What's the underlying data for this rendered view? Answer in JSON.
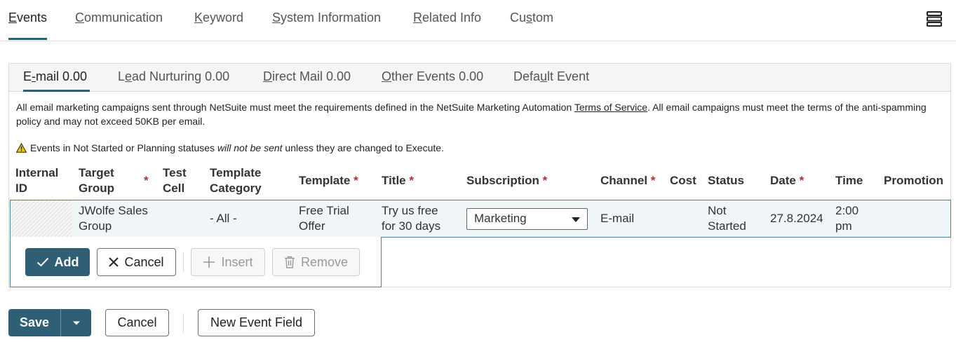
{
  "top_tabs": [
    {
      "pre": "",
      "u": "E",
      "post": "vents"
    },
    {
      "pre": "",
      "u": "C",
      "post": "ommunication"
    },
    {
      "pre": "",
      "u": "K",
      "post": "eyword"
    },
    {
      "pre": "",
      "u": "S",
      "post": "ystem Information"
    },
    {
      "pre": "",
      "u": "R",
      "post": "elated Info"
    },
    {
      "pre": "Cu",
      "u": "s",
      "post": "tom"
    }
  ],
  "sub_tabs": [
    {
      "pre": "E",
      "u": "-",
      "post": "mail 0.00"
    },
    {
      "pre": "L",
      "u": "e",
      "post": "ad Nurturing 0.00"
    },
    {
      "pre": "",
      "u": "D",
      "post": "irect Mail 0.00"
    },
    {
      "pre": "",
      "u": "O",
      "post": "ther Events 0.00"
    },
    {
      "pre": "Defa",
      "u": "u",
      "post": "lt Event"
    }
  ],
  "notice": {
    "before": "All email marketing campaigns sent through NetSuite must meet the requirements defined in the NetSuite Marketing Automation ",
    "link": "Terms of Service",
    "after": ". All email campaigns must meet the terms of the anti-spamming policy and may not exceed 50KB per email."
  },
  "warning": {
    "before": "Events in Not Started or Planning statuses ",
    "emph": "will not be sent",
    "after": " unless they are changed to Execute."
  },
  "table": {
    "headers": {
      "internal_id_1": "Internal",
      "internal_id_2": "ID",
      "target_group_1": "Target",
      "target_group_2": "Group",
      "test_cell_1": "Test",
      "test_cell_2": "Cell",
      "template_category_1": "Template",
      "template_category_2": "Category",
      "template": "Template",
      "title": "Title",
      "subscription": "Subscription",
      "channel": "Channel",
      "cost": "Cost",
      "status": "Status",
      "date": "Date",
      "time": "Time",
      "promotion": "Promotion",
      "required_mark": "*"
    },
    "row": {
      "internal_id": "",
      "target_group_1": "JWolfe Sales",
      "target_group_2": "Group",
      "test_cell": "",
      "template_category": "- All -",
      "template_1": "Free Trial",
      "template_2": "Offer",
      "title_1": "Try us free",
      "title_2": "for 30 days",
      "subscription": "Marketing",
      "channel": "E-mail",
      "cost": "",
      "status_1": "Not",
      "status_2": "Started",
      "date": "27.8.2024",
      "time_1": "2:00",
      "time_2": "pm",
      "promotion": ""
    }
  },
  "row_actions": {
    "add": "Add",
    "cancel": "Cancel",
    "insert": "Insert",
    "remove": "Remove"
  },
  "footer": {
    "save": "Save",
    "cancel": "Cancel",
    "new_event_field": "New Event Field"
  },
  "colors": {
    "primary": "#2f5f75",
    "required": "#aa3333",
    "row_border": "#4a8496",
    "warning": "#f2c200"
  },
  "icons": [
    "hamburger-menu-icon",
    "warning-icon",
    "check-icon",
    "close-icon",
    "plus-icon",
    "trash-icon",
    "chevron-down-icon"
  ]
}
